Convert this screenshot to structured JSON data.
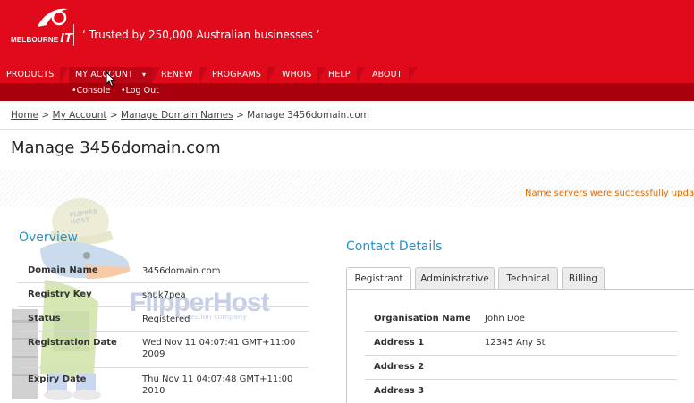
{
  "header": {
    "logo_text": "MELBOURNE",
    "logo_it": "IT",
    "tagline": "‘ Trusted by 250,000 Australian businesses ’",
    "brand_color": "#e10a1a"
  },
  "nav": {
    "items": [
      {
        "label": "PRODUCTS"
      },
      {
        "label": "MY ACCOUNT"
      },
      {
        "label": "RENEW"
      },
      {
        "label": "PROGRAMS"
      },
      {
        "label": "WHOIS"
      },
      {
        "label": "HELP"
      },
      {
        "label": "ABOUT"
      }
    ],
    "subitems": [
      {
        "label": "•Console"
      },
      {
        "label": "•Log Out"
      }
    ]
  },
  "breadcrumb": {
    "home": "Home",
    "my_account": "My Account",
    "manage": "Manage Domain Names",
    "current": "Manage 3456domain.com",
    "sep": ">"
  },
  "page": {
    "title": "Manage 3456domain.com",
    "status_message": "Name servers were successfully update"
  },
  "watermark": {
    "text": "FlipperHost",
    "sub": "investion company",
    "cap": "FLIPPER HOST"
  },
  "overview": {
    "title": "Overview",
    "rows": [
      {
        "label": "Domain Name",
        "value": "3456domain.com"
      },
      {
        "label": "Registry Key",
        "value": "shuk7pea"
      },
      {
        "label": "Status",
        "value": "Registered"
      },
      {
        "label": "Registration Date",
        "value": "Wed Nov 11 04:07:41 GMT+11:00 2009"
      },
      {
        "label": "Expiry Date",
        "value": "Thu Nov 11 04:07:48 GMT+11:00 2010"
      }
    ]
  },
  "contact": {
    "title": "Contact Details",
    "tabs": [
      {
        "label": "Registrant"
      },
      {
        "label": "Administrative"
      },
      {
        "label": "Technical"
      },
      {
        "label": "Billing"
      }
    ],
    "rows": [
      {
        "label": "Organisation Name",
        "value": "John Doe"
      },
      {
        "label": "Address 1",
        "value": "12345 Any St"
      },
      {
        "label": "Address 2",
        "value": ""
      },
      {
        "label": "Address 3",
        "value": ""
      }
    ]
  }
}
